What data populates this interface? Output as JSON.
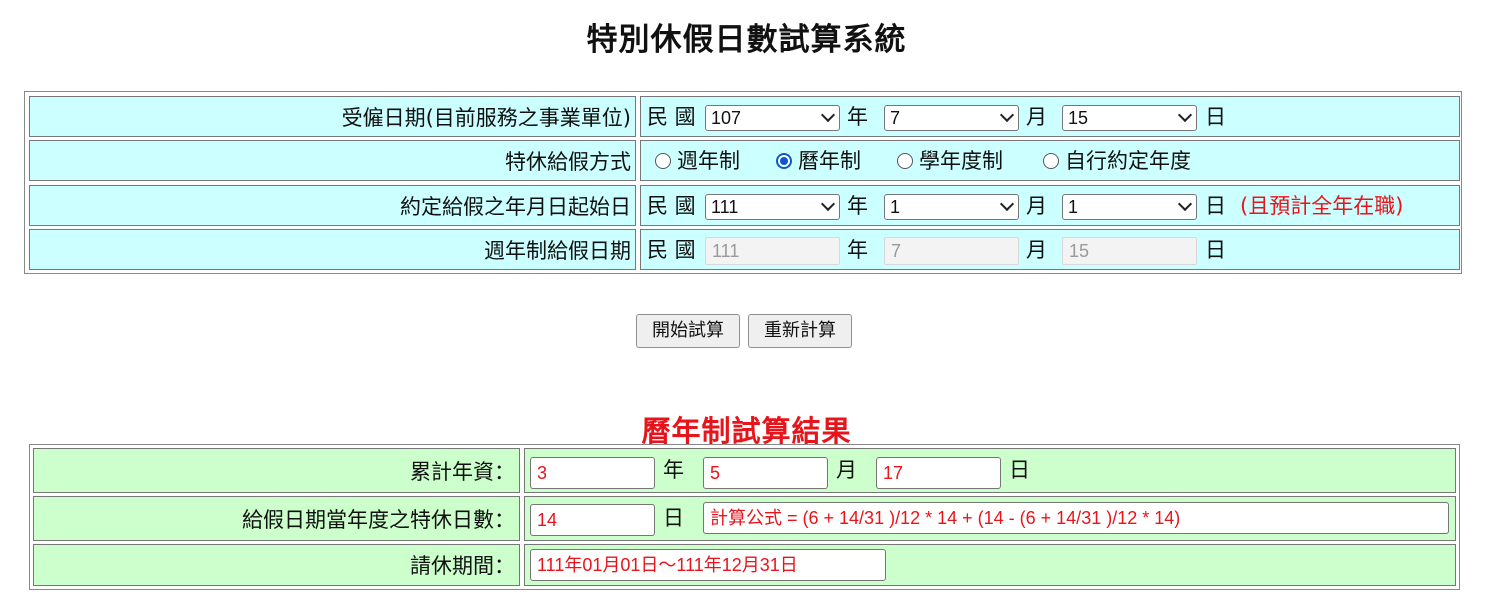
{
  "page_title": "特別休假日數試算系統",
  "form": {
    "hire_date": {
      "label": "受僱日期(目前服務之事業單位)",
      "prefix": "民 國",
      "year": "107",
      "year_unit": "年",
      "month": "7",
      "month_unit": "月",
      "day": "15",
      "day_unit": "日"
    },
    "leave_method": {
      "label": "特休給假方式",
      "options": [
        "週年制",
        "曆年制",
        "學年度制",
        "自行約定年度"
      ],
      "selected": "曆年制"
    },
    "agreed_start": {
      "label": "約定給假之年月日起始日",
      "prefix": "民 國",
      "year": "111",
      "year_unit": "年",
      "month": "1",
      "month_unit": "月",
      "day": "1",
      "day_unit": "日",
      "note": "(且預計全年在職)"
    },
    "anniversary_date": {
      "label": "週年制給假日期",
      "prefix": "民 國",
      "year": "111",
      "year_unit": "年",
      "month": "7",
      "month_unit": "月",
      "day": "15",
      "day_unit": "日"
    }
  },
  "buttons": {
    "start": "開始試算",
    "reset": "重新計算"
  },
  "result": {
    "title": "曆年制試算結果",
    "seniority": {
      "label": "累計年資：",
      "years": "3",
      "years_unit": "年",
      "months": "5",
      "months_unit": "月",
      "days": "17",
      "days_unit": "日"
    },
    "leave_days": {
      "label": "給假日期當年度之特休日數：",
      "value": "14",
      "unit": "日",
      "formula": "計算公式 = (6 + 14/31 )/12 * 14 + (14 - (6 + 14/31 )/12 * 14)"
    },
    "leave_period": {
      "label": "請休期間：",
      "value": "111年01月01日～111年12月31日"
    }
  },
  "colors": {
    "input_rows_bg": "#ccffff",
    "result_rows_bg": "#ccffcc",
    "accent_red": "#e8141b",
    "radio_blue": "#0b57d0"
  }
}
